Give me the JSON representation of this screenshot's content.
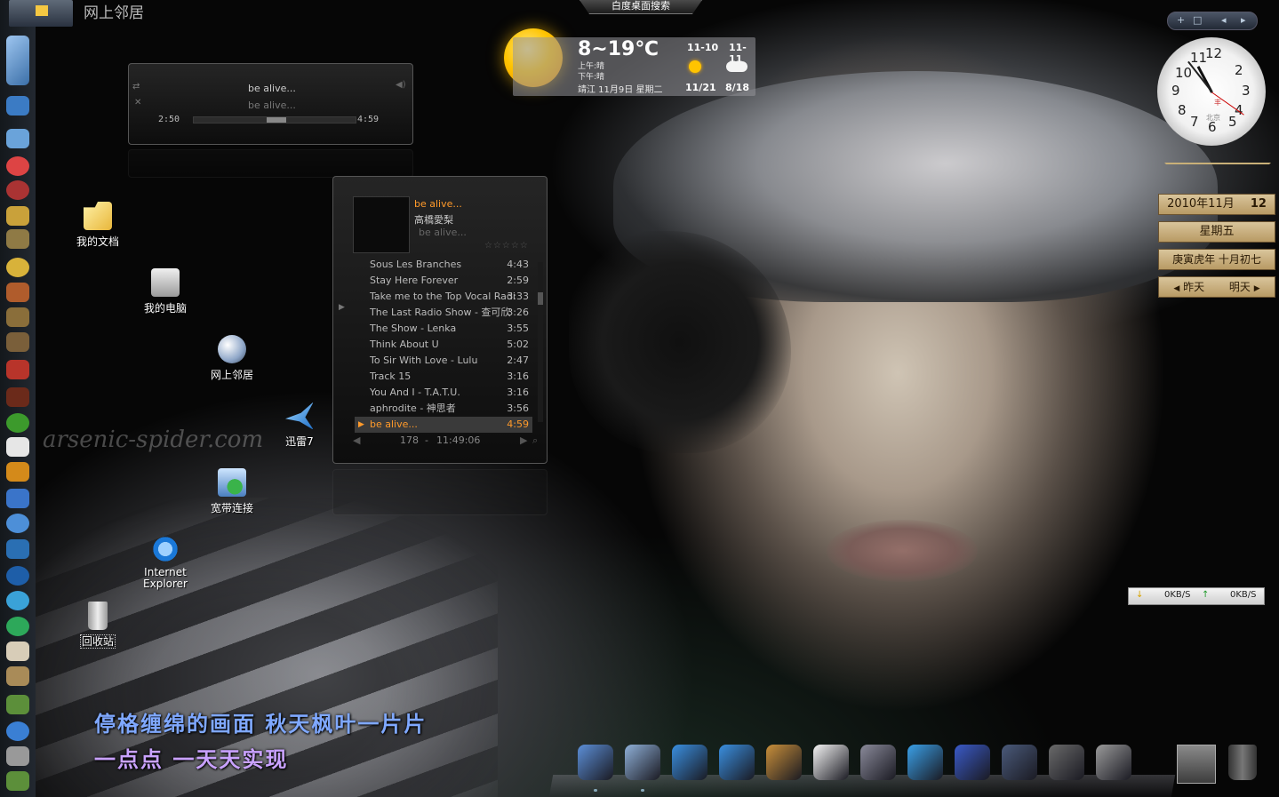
{
  "window": {
    "title": "网上邻居"
  },
  "search_tab": {
    "label": "白度桌面搜索"
  },
  "desktop_icons": [
    {
      "label": "我的文档",
      "icon": "folder-document-icon"
    },
    {
      "label": "我的电脑",
      "icon": "computer-icon"
    },
    {
      "label": "网上邻居",
      "icon": "network-globe-icon"
    },
    {
      "label": "迅雷7",
      "icon": "thunder-bird-icon"
    },
    {
      "label": "宽带连接",
      "icon": "broadband-connection-icon"
    },
    {
      "label": "Internet Explorer",
      "icon": "internet-explorer-icon"
    },
    {
      "label": "回收站",
      "icon": "recycle-bin-icon"
    }
  ],
  "weather": {
    "temperature": "8~19℃",
    "morning": "上午:晴",
    "afternoon": "下午:晴",
    "location_date": "靖江 11月9日 星期二",
    "forecast": [
      {
        "date": "11-10",
        "range": "11/21",
        "icon": "sun-icon"
      },
      {
        "date": "11-11",
        "range": "8/18",
        "icon": "cloud-icon"
      }
    ]
  },
  "clock": {
    "sub_text": "北京",
    "brand": "丰"
  },
  "calendar": {
    "year_month": "2010年11月",
    "day": "12",
    "weekday": "星期五",
    "lunar": "庚寅虎年 十月初七",
    "prev": "昨天",
    "next": "明天"
  },
  "network": {
    "down": "0KB/S",
    "up": "0KB/S"
  },
  "mini_player": {
    "title_line1": "be alive...",
    "title_line2": "be alive...",
    "elapsed": "2:50",
    "total": "4:59",
    "progress": 0.57
  },
  "playlist": {
    "now_playing": {
      "title": "be alive...",
      "artist": "高橋愛梨",
      "album": "be alive..."
    },
    "tracks": [
      {
        "name": "Sous Les Branches",
        "time": "4:43"
      },
      {
        "name": "Stay Here Forever",
        "time": "2:59"
      },
      {
        "name": "Take me to the Top Vocal Radi",
        "time": "3:33"
      },
      {
        "name": "The Last Radio Show - 查可欣",
        "time": "3:26"
      },
      {
        "name": "The Show - Lenka",
        "time": "3:55"
      },
      {
        "name": "Think About U",
        "time": "5:02"
      },
      {
        "name": "To Sir With Love - Lulu",
        "time": "2:47"
      },
      {
        "name": "Track 15",
        "time": "3:16"
      },
      {
        "name": "You And I - T.A.T.U.",
        "time": "3:16"
      },
      {
        "name": "aphrodite - 神思者",
        "time": "3:56"
      },
      {
        "name": "be alive...",
        "time": "4:59",
        "active": true
      }
    ],
    "count": "178",
    "total_time": "11:49:06"
  },
  "lyrics": {
    "line1": "停格缠绵的画面  秋天枫叶一片片",
    "line2": "一点点  一天天实现"
  },
  "watermark": "arsenic-spider.com",
  "dock": [
    "finder-icon",
    "mail-icon",
    "safari-icon",
    "ichat-icon",
    "address-book-icon",
    "ical-icon",
    "iphoto-icon",
    "itunes-icon",
    "imovie-icon",
    "dashboard-icon",
    "time-machine-icon",
    "system-preferences-icon"
  ],
  "colors": {
    "lyric_top": "#7fa8ff",
    "lyric_mid": "#c9a2ff",
    "accent_orange": "#ff9a2a"
  }
}
